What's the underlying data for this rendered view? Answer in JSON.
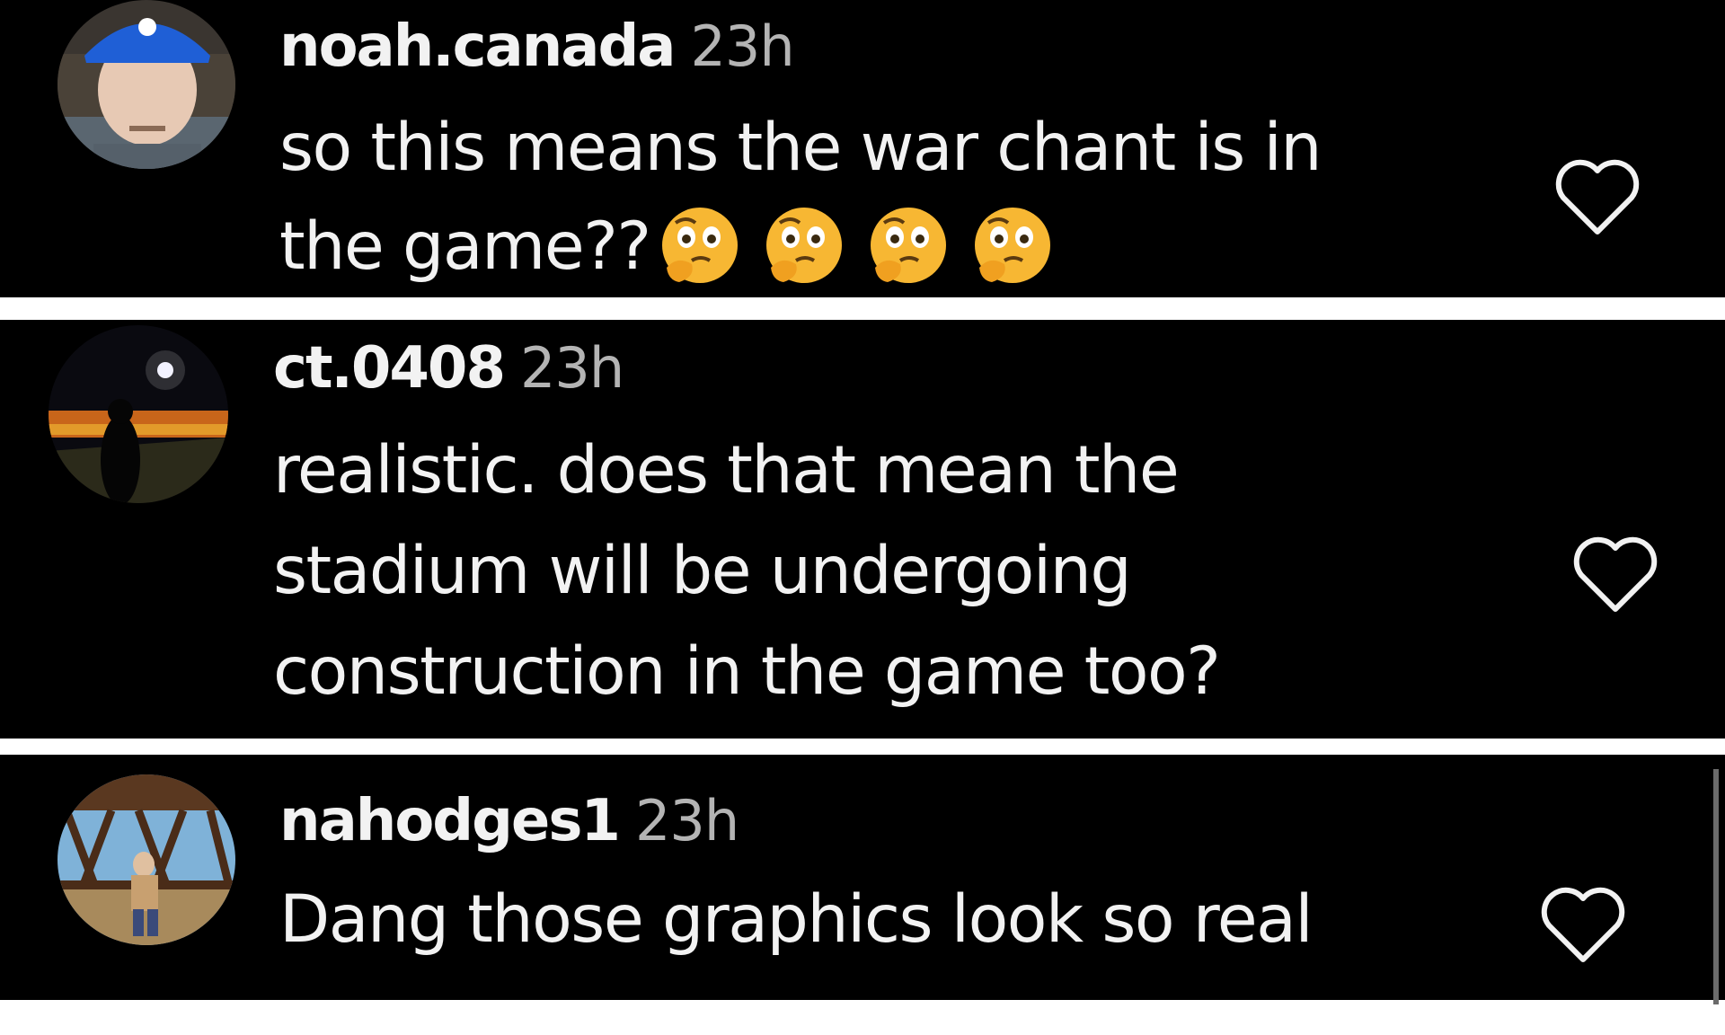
{
  "comments": [
    {
      "username": "noah.canada",
      "time": "23h",
      "text_lines": [
        "so this means the war chant is in",
        "the game??"
      ],
      "emojis": [
        "thinking-face-emoji",
        "thinking-face-emoji",
        "thinking-face-emoji",
        "thinking-face-emoji"
      ],
      "avatar": "profile-photo-man-blue-cap",
      "like_icon": "heart-outline-icon"
    },
    {
      "username": "ct.0408",
      "time": "23h",
      "text_lines": [
        "realistic. does that mean the",
        "stadium will be undergoing",
        "construction in the game too?"
      ],
      "avatar": "profile-photo-silhouette-night",
      "like_icon": "heart-outline-icon"
    },
    {
      "username": "nahodges1",
      "time": "23h",
      "text_lines": [
        "Dang those graphics look so real"
      ],
      "avatar": "profile-photo-person-bridge",
      "like_icon": "heart-outline-icon"
    }
  ],
  "colors": {
    "background": "#000000",
    "separator": "#ffffff",
    "text": "#f2f2f2",
    "timestamp": "#b4b4b4",
    "emoji_face": "#f7b733"
  }
}
